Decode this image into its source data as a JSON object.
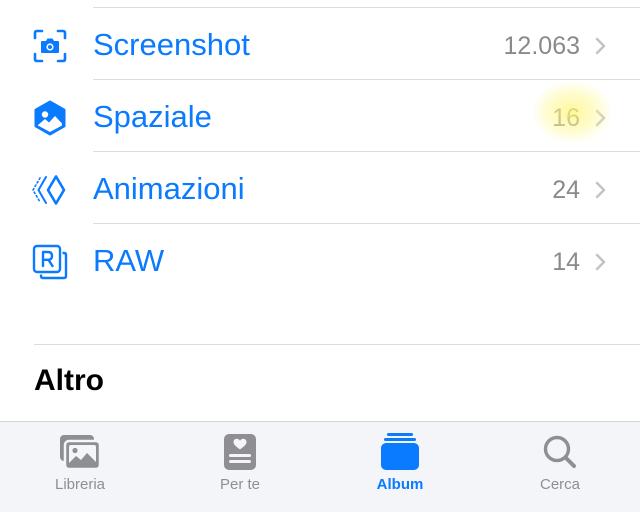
{
  "albums": [
    {
      "label": "Screenshot",
      "count": "12.063",
      "icon": "screenshot-icon"
    },
    {
      "label": "Spaziale",
      "count": "16",
      "icon": "spatial-icon"
    },
    {
      "label": "Animazioni",
      "count": "24",
      "icon": "animations-icon"
    },
    {
      "label": "RAW",
      "count": "14",
      "icon": "raw-icon"
    }
  ],
  "section": {
    "title": "Altro"
  },
  "tabbar": {
    "tabs": [
      {
        "label": "Libreria",
        "icon": "photos-library-icon",
        "active": false
      },
      {
        "label": "Per te",
        "icon": "for-you-icon",
        "active": false
      },
      {
        "label": "Album",
        "icon": "album-icon",
        "active": true
      },
      {
        "label": "Cerca",
        "icon": "search-icon",
        "active": false
      }
    ]
  },
  "colors": {
    "accent": "#0a7aff",
    "secondary_text": "#8a8a8e",
    "tab_inactive": "#8e8e93",
    "tabbar_background": "#f4f5f9",
    "highlight": "#fff578"
  }
}
